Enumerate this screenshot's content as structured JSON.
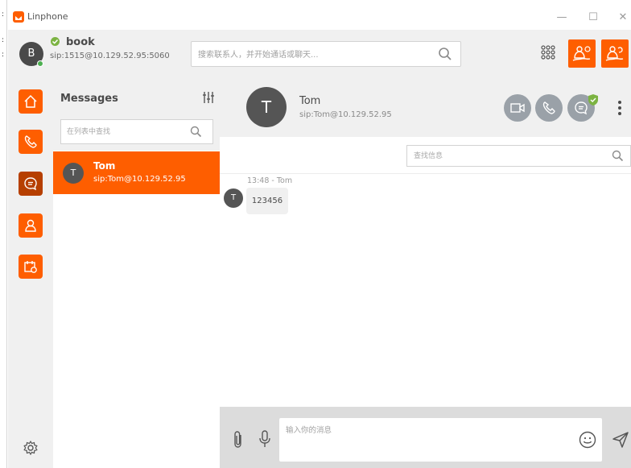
{
  "window": {
    "title": "Linphone",
    "controls": {
      "minimize": "—",
      "maximize": "☐",
      "close": "✕"
    },
    "edge_marks": [
      ":",
      ":",
      ":"
    ]
  },
  "account": {
    "avatar_initial": "B",
    "name": "book",
    "sip": "sip:1515@10.129.52.95:5060",
    "status": "online"
  },
  "search": {
    "placeholder": "搜索联系人，并开始通话或聊天..."
  },
  "header_buttons": [
    "dialpad-icon",
    "conference-icon",
    "conference-invite-icon"
  ],
  "nav": {
    "items": [
      {
        "name": "home-icon",
        "active": false
      },
      {
        "name": "phone-icon",
        "active": false
      },
      {
        "name": "chat-icon",
        "active": true
      },
      {
        "name": "contacts-icon",
        "active": false
      },
      {
        "name": "meetings-icon",
        "active": false
      }
    ],
    "settings_icon": "gear-icon"
  },
  "conversations": {
    "title": "Messages",
    "search_placeholder": "在列表中查找",
    "items": [
      {
        "avatar_initial": "T",
        "name": "Tom",
        "sip": "sip:Tom@10.129.52.95",
        "selected": true
      }
    ]
  },
  "chat": {
    "peer": {
      "avatar_initial": "T",
      "name": "Tom",
      "sip": "sip:Tom@10.129.52.95"
    },
    "actions": [
      "video-call-icon",
      "call-icon",
      "chat-security-icon",
      "more-icon"
    ],
    "search_placeholder": "查找信息",
    "messages": [
      {
        "meta": "13:48 - Tom",
        "avatar_initial": "T",
        "text": "123456"
      }
    ],
    "composer_placeholder": "输入你的消息"
  },
  "colors": {
    "accent": "#fe5e00",
    "accent_dark": "#b63f00",
    "panel_bg": "#f0f0f0",
    "composer_bg": "#dcdcdc",
    "round_button": "#9aa1a8",
    "status_green": "#7cb342"
  }
}
